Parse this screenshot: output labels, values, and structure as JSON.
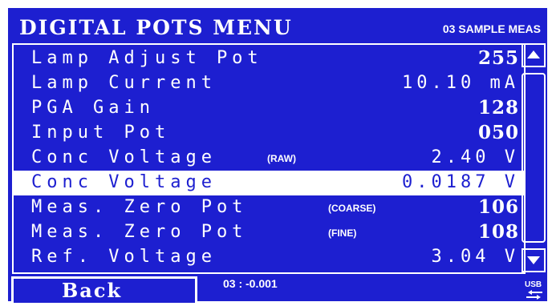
{
  "header": {
    "title": "DIGITAL POTS MENU",
    "subtitle": "03 SAMPLE MEAS"
  },
  "rows": [
    {
      "label": "Lamp Adjust Pot",
      "note": "",
      "value": "255"
    },
    {
      "label": "Lamp Current",
      "note": "",
      "value": "10.10 mA"
    },
    {
      "label": "PGA Gain",
      "note": "",
      "value": "128"
    },
    {
      "label": "Input Pot",
      "note": "",
      "value": "050"
    },
    {
      "label": "Conc Voltage",
      "note": "(RAW)",
      "value": "2.40 V"
    },
    {
      "label": "Conc Voltage",
      "note": "",
      "value": "0.0187 V"
    },
    {
      "label": "Meas. Zero Pot",
      "note": "(COARSE)",
      "value": "106"
    },
    {
      "label": "Meas. Zero Pot",
      "note": "(FINE)",
      "value": "108"
    },
    {
      "label": "Ref. Voltage",
      "note": "",
      "value": "3.04 V"
    }
  ],
  "footer": {
    "back_label": "Back",
    "status": "03 : -0.001",
    "usb_label": "USB"
  },
  "icons": {
    "scroll_up": "up-arrow-icon",
    "scroll_down": "down-arrow-icon",
    "usb": "usb-icon"
  },
  "colors": {
    "background": "#1d1fd0",
    "foreground": "#ffffff",
    "selected_row_bg": "#ffffff",
    "selected_row_text": "#1d1fd0"
  }
}
